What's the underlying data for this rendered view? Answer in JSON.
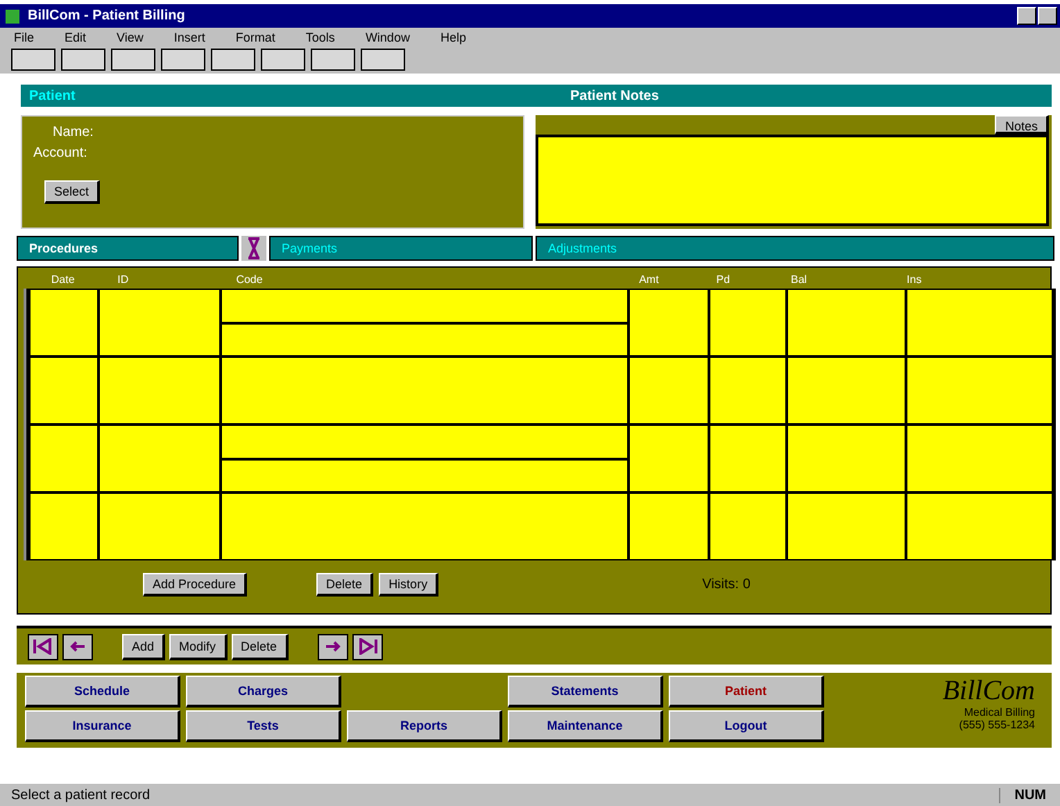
{
  "window": {
    "title": "BillCom - Patient Billing"
  },
  "menu": [
    "File",
    "Edit",
    "View",
    "Insert",
    "Format",
    "Tools",
    "Window",
    "Help"
  ],
  "header": {
    "left": "Patient",
    "right": "Patient Notes"
  },
  "patient": {
    "name_label": "Name:",
    "account_label": "Account:",
    "button": "Select"
  },
  "notes": {
    "button": "Notes"
  },
  "tabs": [
    {
      "label": "Procedures",
      "selected": true
    },
    {
      "label": "Payments",
      "selected": false
    },
    {
      "label": "Adjustments",
      "selected": false
    }
  ],
  "grid": {
    "columns": [
      "Date",
      "ID",
      "Code",
      "Amt",
      "Pd",
      "Bal",
      "Ins"
    ]
  },
  "grid_buttons": [
    "Add Procedure",
    "Delete",
    "History"
  ],
  "visits": "Visits: 0",
  "nav": {
    "buttons": [
      "Add",
      "Modify",
      "Delete"
    ]
  },
  "actions": [
    [
      {
        "label": "Schedule",
        "color": "#000080"
      },
      {
        "label": "Charges",
        "color": "#000080"
      },
      {
        "label": "Statements",
        "color": "#000080"
      },
      {
        "label": "Patient",
        "color": "#a00000"
      }
    ],
    [
      {
        "label": "Insurance",
        "color": "#000080"
      },
      {
        "label": "Tests",
        "color": "#000080"
      },
      {
        "label": "Reports",
        "color": "#000080"
      },
      {
        "label": "Maintenance",
        "color": "#000080"
      },
      {
        "label": "Logout",
        "color": "#000080"
      }
    ]
  ],
  "logo": {
    "name": "BillCom",
    "line1": "Medical Billing",
    "line2": "(555) 555-1234"
  },
  "status_bar": {
    "text": "Select a patient record",
    "indicator": "NUM"
  }
}
